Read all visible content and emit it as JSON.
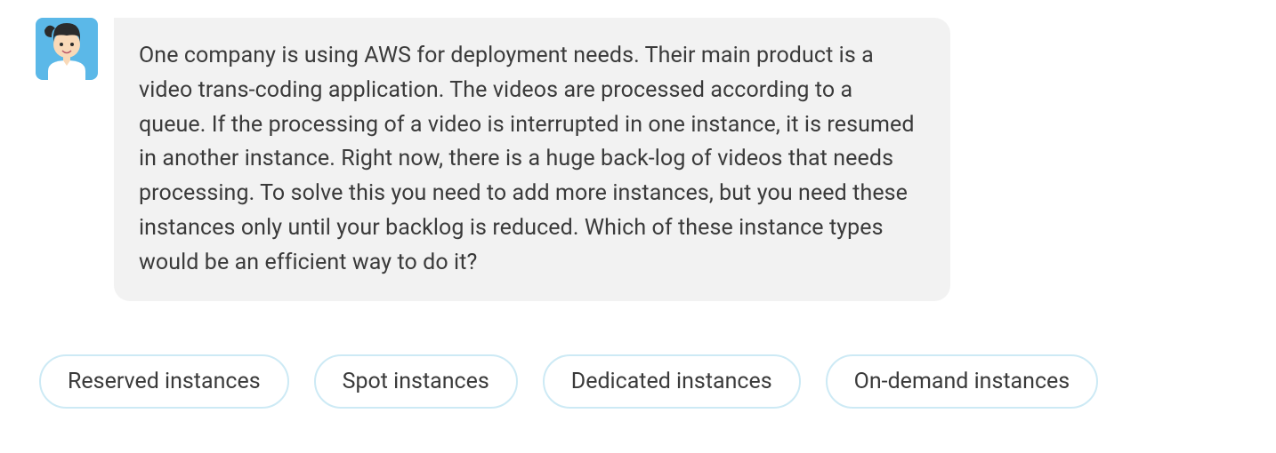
{
  "message": {
    "text": "One company is using AWS for deployment needs. Their main product is a video trans-coding application. The videos are processed according to a queue. If the processing of a video is interrupted in one instance, it is resumed in another instance. Right now, there is a huge back-log of videos that needs processing. To solve this you need to add more instances, but you need these instances only until your backlog is reduced. Which of these instance types would be an efficient way to do it?"
  },
  "options": [
    {
      "label": "Reserved instances"
    },
    {
      "label": "Spot instances"
    },
    {
      "label": "Dedicated instances"
    },
    {
      "label": "On-demand instances"
    }
  ]
}
